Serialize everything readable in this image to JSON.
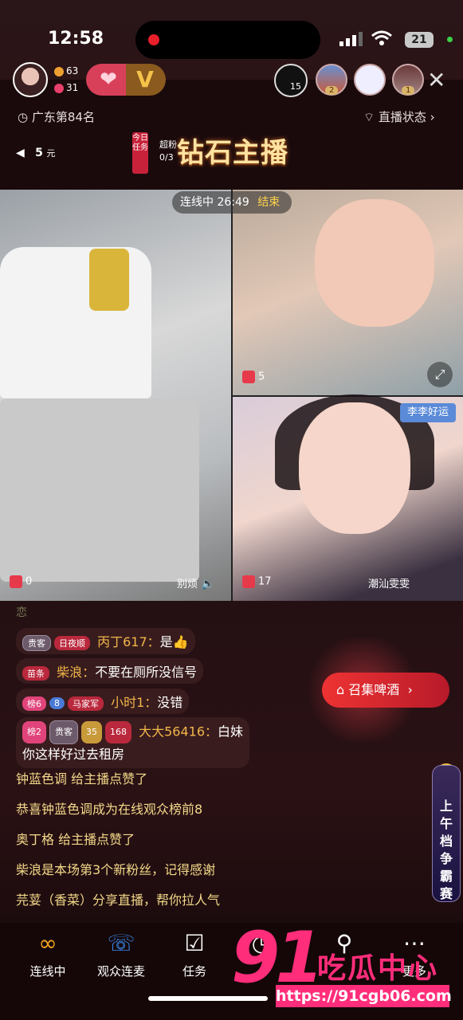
{
  "status_bar": {
    "time": "12:58",
    "battery": "21"
  },
  "host": {
    "stat_fans": "63",
    "stat_likes": "31"
  },
  "viewers": [
    {
      "badge": "2"
    },
    {
      "badge": ""
    },
    {
      "badge": "1"
    }
  ],
  "rank_badge": "15",
  "location": "广东第84名",
  "live_status": "直播状态",
  "pk": {
    "amount": "5",
    "unit": "元"
  },
  "task": {
    "tag": "今日任务",
    "progress_label": "超粉",
    "progress": "0/3",
    "title": "钻石主播"
  },
  "connection": {
    "label": "连线中",
    "timer": "26:49",
    "end": "结束"
  },
  "videos": [
    {
      "gift_count": "0",
      "name": "别烦"
    },
    {
      "gift_count": "5"
    },
    {
      "gift_count": "17",
      "name": "潮汕雯雯",
      "tag": "李李好运"
    }
  ],
  "chat": {
    "faded": "恋",
    "lines": [
      {
        "badges": [
          "贵客",
          "日夜顺"
        ],
        "user": "丙丁617：",
        "text": "是👍"
      },
      {
        "badges": [
          "苗条"
        ],
        "user": "柴浪：",
        "text": "不要在厕所没信号"
      },
      {
        "badges": [
          "榜6",
          "8",
          "马家军"
        ],
        "user": "小时1：",
        "text": "没错"
      },
      {
        "badges": [
          "榜2",
          "贵客",
          "35",
          "168"
        ],
        "user": "大大56416：",
        "text": "白妹",
        "text2": "你这样好过去租房"
      }
    ],
    "system": [
      "钟蓝色调 给主播点赞了",
      "恭喜钟蓝色调成为在线观众榜前8",
      "奥丁格 给主播点赞了",
      "柴浪是本场第3个新粉丝，记得感谢",
      "芫荽（香菜）分享直播，帮你拉人气"
    ]
  },
  "promo": {
    "label": "召集啤酒"
  },
  "side_banner": {
    "label": "上午档争霸赛"
  },
  "nav": [
    {
      "label": "连线中",
      "icon": "link-icon"
    },
    {
      "label": "观众连麦",
      "icon": "phone-icon"
    },
    {
      "label": "任务",
      "icon": "clipboard-icon"
    },
    {
      "label": "",
      "icon": "clock-icon"
    },
    {
      "label": "",
      "icon": "settings-icon"
    },
    {
      "label": "更多",
      "icon": "more-icon"
    }
  ],
  "watermark": {
    "num": "91",
    "text": "吃瓜中心",
    "url": "https://91cgb06.com"
  }
}
